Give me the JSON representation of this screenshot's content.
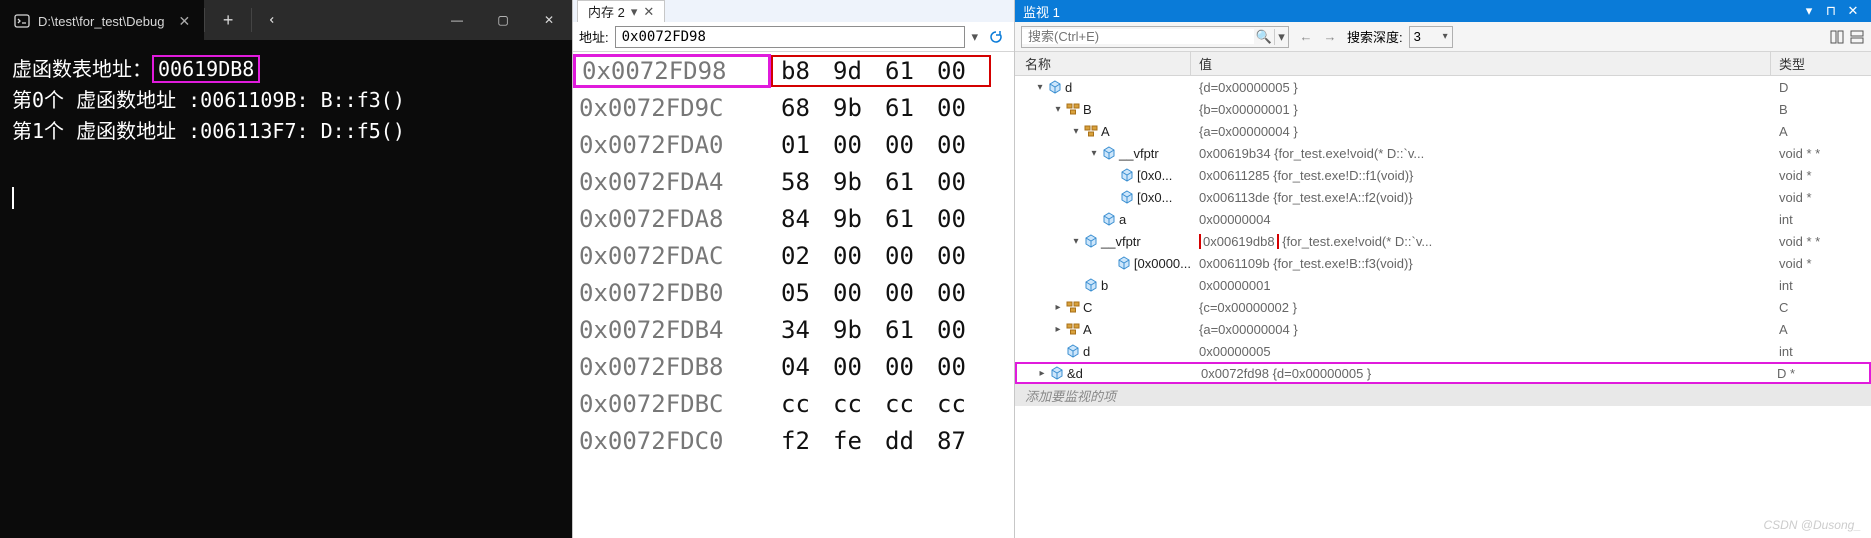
{
  "console": {
    "tab_title": "D:\\test\\for_test\\Debug",
    "lines": [
      {
        "prefix": "虚函数表地址：",
        "hex": "00619DB8",
        "suffix": "",
        "highlight": true
      },
      {
        "prefix": " 第0个 虚函数地址  :",
        "hex": "0061109B",
        "suffix": ":   B::f3()",
        "highlight": false
      },
      {
        "prefix": " 第1个 虚函数地址  :",
        "hex": "006113F7",
        "suffix": ":   D::f5()",
        "highlight": false
      }
    ]
  },
  "memory": {
    "tab_label": "内存 2",
    "addr_label": "地址:",
    "addr_value": "0x0072FD98",
    "rows": [
      {
        "addr": "0x0072FD98",
        "bytes": [
          "b8",
          "9d",
          "61",
          "00"
        ],
        "hl_addr": true,
        "hl_bytes": true
      },
      {
        "addr": "0x0072FD9C",
        "bytes": [
          "68",
          "9b",
          "61",
          "00"
        ]
      },
      {
        "addr": "0x0072FDA0",
        "bytes": [
          "01",
          "00",
          "00",
          "00"
        ]
      },
      {
        "addr": "0x0072FDA4",
        "bytes": [
          "58",
          "9b",
          "61",
          "00"
        ]
      },
      {
        "addr": "0x0072FDA8",
        "bytes": [
          "84",
          "9b",
          "61",
          "00"
        ]
      },
      {
        "addr": "0x0072FDAC",
        "bytes": [
          "02",
          "00",
          "00",
          "00"
        ]
      },
      {
        "addr": "0x0072FDB0",
        "bytes": [
          "05",
          "00",
          "00",
          "00"
        ]
      },
      {
        "addr": "0x0072FDB4",
        "bytes": [
          "34",
          "9b",
          "61",
          "00"
        ]
      },
      {
        "addr": "0x0072FDB8",
        "bytes": [
          "04",
          "00",
          "00",
          "00"
        ]
      },
      {
        "addr": "0x0072FDBC",
        "bytes": [
          "cc",
          "cc",
          "cc",
          "cc"
        ]
      },
      {
        "addr": "0x0072FDC0",
        "bytes": [
          "f2",
          "fe",
          "dd",
          "87"
        ]
      }
    ]
  },
  "watch": {
    "title": "监视 1",
    "search_placeholder": "搜索(Ctrl+E)",
    "depth_label": "搜索深度:",
    "depth_value": "3",
    "columns": {
      "name": "名称",
      "value": "值",
      "type": "类型"
    },
    "add_row_label": "添加要监视的项",
    "rows": [
      {
        "indent": 1,
        "exp": "▾",
        "icon": "cube",
        "name": "d",
        "value": "{d=0x00000005 }",
        "type": "D"
      },
      {
        "indent": 2,
        "exp": "▾",
        "icon": "struct",
        "name": "B",
        "value": "{b=0x00000001 }",
        "type": "B"
      },
      {
        "indent": 3,
        "exp": "▾",
        "icon": "struct",
        "name": "A",
        "value": "{a=0x00000004 }",
        "type": "A"
      },
      {
        "indent": 4,
        "exp": "▾",
        "icon": "cube",
        "name": "__vfptr",
        "value": "0x00619b34 {for_test.exe!void(* D::`v...",
        "type": "void * *"
      },
      {
        "indent": 5,
        "exp": "",
        "icon": "cube",
        "name": "[0x0...",
        "value": "0x00611285 {for_test.exe!D::f1(void)}",
        "type": "void *"
      },
      {
        "indent": 5,
        "exp": "",
        "icon": "cube",
        "name": "[0x0...",
        "value": "0x006113de {for_test.exe!A::f2(void)}",
        "type": "void *"
      },
      {
        "indent": 4,
        "exp": "",
        "icon": "cube",
        "name": "a",
        "value": "0x00000004",
        "type": "int"
      },
      {
        "indent": 3,
        "exp": "▾",
        "icon": "cube",
        "name": "__vfptr",
        "value_pre": "",
        "box": "0x00619db8",
        "value_post": " {for_test.exe!void(* D::`v...",
        "type": "void * *",
        "hl": "red"
      },
      {
        "indent": 5,
        "exp": "",
        "icon": "cube",
        "name": "[0x0000...",
        "value": "0x0061109b {for_test.exe!B::f3(void)}",
        "type": "void *"
      },
      {
        "indent": 3,
        "exp": "",
        "icon": "cube",
        "name": "b",
        "value": "0x00000001",
        "type": "int"
      },
      {
        "indent": 2,
        "exp": "▸",
        "icon": "struct",
        "name": "C",
        "value": "{c=0x00000002 }",
        "type": "C"
      },
      {
        "indent": 2,
        "exp": "▸",
        "icon": "struct",
        "name": "A",
        "value": "{a=0x00000004 }",
        "type": "A"
      },
      {
        "indent": 2,
        "exp": "",
        "icon": "cube",
        "name": "d",
        "value": "0x00000005",
        "type": "int"
      },
      {
        "indent": 1,
        "exp": "▸",
        "icon": "cube",
        "name": "&d",
        "value": "0x0072fd98 {d=0x00000005 }",
        "type": "D *",
        "hl": "magenta"
      }
    ]
  },
  "watermark": "CSDN @Dusong_"
}
